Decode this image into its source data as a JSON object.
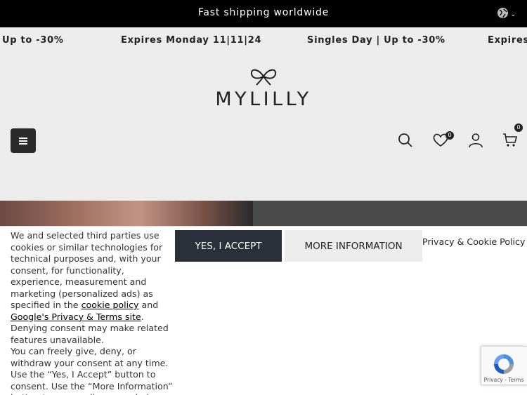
{
  "topbar": {
    "shipping_text": "Fast shipping worldwide",
    "language_icon": "globe-icon"
  },
  "marquee": {
    "items": [
      "Up to -30%",
      "Expires Monday 11|11|24",
      "Singles Day | Up to -30%",
      "Expires M"
    ]
  },
  "header": {
    "logo_text": "MYLILLY",
    "wishlist_count": "0",
    "cart_count": "0"
  },
  "consent": {
    "text_part1": "We and selected third parties use cookies or similar technologies for technical purposes and, with your consent, for functionality, experience, measurement and marketing (personalized ads) as specified in the ",
    "cookie_policy_link": "cookie policy",
    "text_and": " and ",
    "google_link": "Google's Privacy & Terms site",
    "text_part2": ". Denying consent may make related features unavailable.",
    "text_part3": "You can freely give, deny, or withdraw your consent at any time.",
    "text_part4": "Use the “Yes, I Accept” button to consent. Use the “More Information” button to personalize your choice.",
    "accept_label": "YES, I ACCEPT",
    "more_info_label": "MORE INFORMATION",
    "privacy_link": "Privacy & Cookie Policy"
  },
  "recaptcha": {
    "caption": "Privacy - Terms"
  }
}
